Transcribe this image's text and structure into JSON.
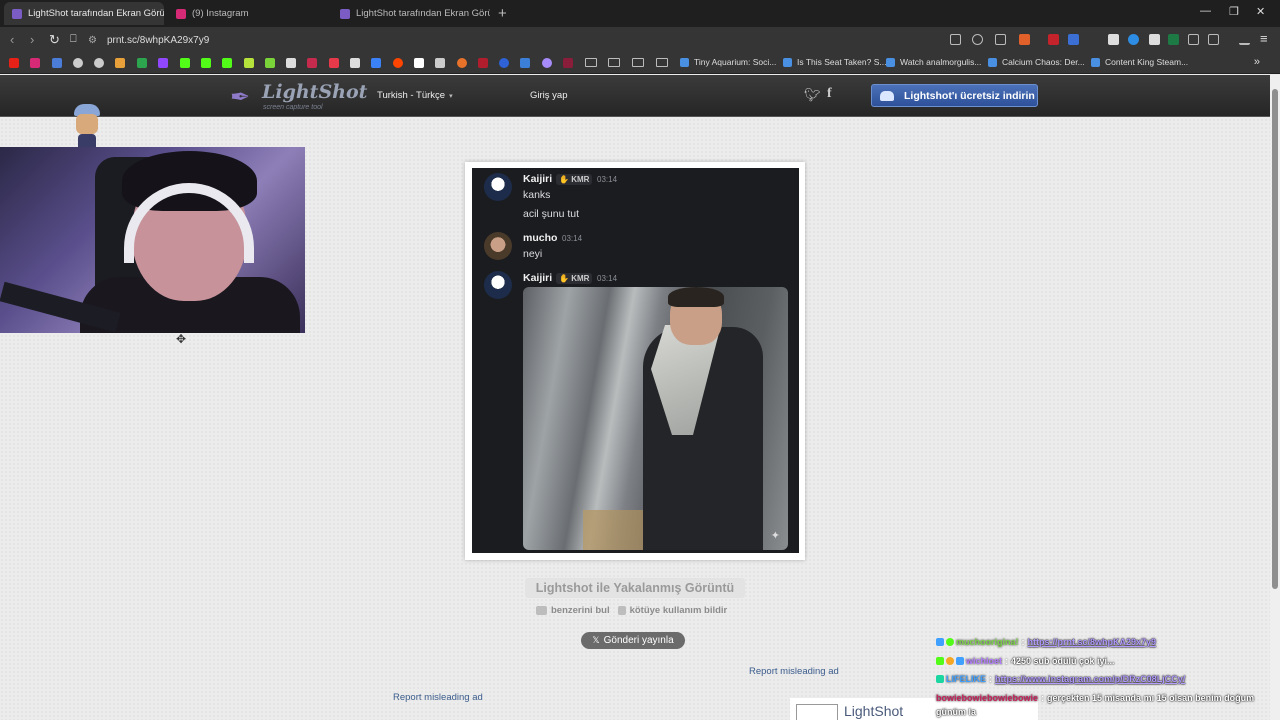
{
  "browser": {
    "tabs": [
      {
        "title": "LightShot tarafından Ekran Görüntüsü",
        "active": true
      },
      {
        "title": "(9) Instagram",
        "active": false
      },
      {
        "title": "LightShot tarafından Ekran Görüntüsü",
        "active": false
      }
    ],
    "url": "prnt.sc/8whpKA29x7y9",
    "bookmarks": [
      "Tiny Aquarium: Soci...",
      "Is This Seat Taken? S...",
      "Watch analmorgulis...",
      "Calcium Chaos: Der...",
      "Content King Steam..."
    ],
    "colors": {
      "tabbar": "#1f1f1f",
      "toolbar": "#353535"
    }
  },
  "lightshot": {
    "logo_name": "LightShot",
    "logo_tagline": "screen capture tool",
    "language": "Turkish - Türkçe",
    "login": "Giriş yap",
    "download_button": "Lightshot'ı ücretsiz indirin",
    "screenshot_title": "Lightshot ile Yakalanmış Görüntü",
    "find_similar": "benzerini bul",
    "report_abuse": "kötüye kullanım bildir",
    "tweet_button": "Gönderi yayınla",
    "report_ad_1": "Report misleading ad",
    "report_ad_2": "Report misleading ad",
    "ad_logo": "LightShot"
  },
  "discord": {
    "messages": [
      {
        "author": "Kaijiri",
        "badge": "KMR",
        "time": "03:14",
        "lines": [
          "kanks",
          "acil şunu tut"
        ]
      },
      {
        "author": "mucho",
        "time": "03:14",
        "lines": [
          "neyi"
        ]
      },
      {
        "author": "Kaijiri",
        "badge": "KMR",
        "time": "03:14",
        "lines": []
      }
    ]
  },
  "chat": [
    {
      "user": "muchoorigina!",
      "user_color": "#7cd348",
      "message": "https://prnt.sc/8whpKA29x7y9",
      "link": true
    },
    {
      "user": "wichloet",
      "user_color": "#b37cff",
      "message": "4250 sub ödülü çok iyi...",
      "link": false
    },
    {
      "user": "LIFELIKE",
      "user_color": "#3fa0ff",
      "message": "https://www.instagram.com/p/DRzC08LjCCy/",
      "link": true
    },
    {
      "user": "bowiebowiebowiebowie",
      "user_color": "#c71f5a",
      "message": "gerçekten 15 misanda mı 15 olsan benim doğum günüm la",
      "link": false
    }
  ]
}
